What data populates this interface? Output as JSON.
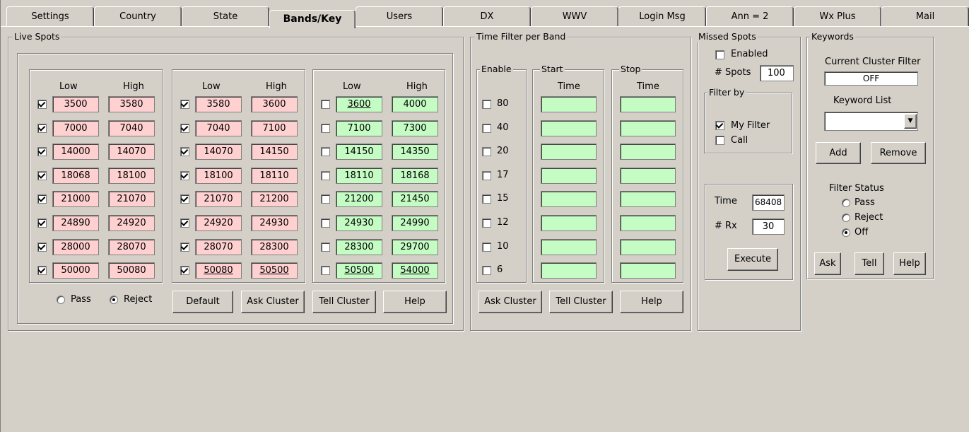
{
  "tabs": [
    "Settings",
    "Country",
    "State",
    "Bands/Key",
    "Users",
    "DX",
    "WWV",
    "Login Msg",
    "Ann = 2",
    "Wx Plus",
    "Mail"
  ],
  "live_spots": {
    "title": "Live Spots",
    "col_low": "Low",
    "col_high": "High",
    "groups": [
      {
        "checked": true,
        "color": "pink",
        "rows": [
          [
            "3500",
            "3580"
          ],
          [
            "7000",
            "7040"
          ],
          [
            "14000",
            "14070"
          ],
          [
            "18068",
            "18100"
          ],
          [
            "21000",
            "21070"
          ],
          [
            "24890",
            "24920"
          ],
          [
            "28000",
            "28070"
          ],
          [
            "50000",
            "50080"
          ]
        ]
      },
      {
        "checked": true,
        "color": "pink",
        "rows": [
          [
            "3580",
            "3600"
          ],
          [
            "7040",
            "7100"
          ],
          [
            "14070",
            "14150"
          ],
          [
            "18100",
            "18110"
          ],
          [
            "21070",
            "21200"
          ],
          [
            "24920",
            "24930"
          ],
          [
            "28070",
            "28300"
          ],
          [
            "50080",
            "50500"
          ]
        ]
      },
      {
        "checked": false,
        "color": "green",
        "rows": [
          [
            "3600",
            "4000"
          ],
          [
            "7100",
            "7300"
          ],
          [
            "14150",
            "14350"
          ],
          [
            "18110",
            "18168"
          ],
          [
            "21200",
            "21450"
          ],
          [
            "24930",
            "24990"
          ],
          [
            "28300",
            "29700"
          ],
          [
            "50500",
            "54000"
          ]
        ]
      }
    ],
    "pass_label": "Pass",
    "reject_label": "Reject",
    "default_btn": "Default",
    "ask_btn": "Ask Cluster",
    "tell_btn": "Tell Cluster",
    "help_btn": "Help"
  },
  "time_filter": {
    "title": "Time Filter per Band",
    "enable_title": "Enable",
    "start_title": "Start",
    "stop_title": "Stop",
    "time_label": "Time",
    "bands": [
      "80",
      "40",
      "20",
      "17",
      "15",
      "12",
      "10",
      "6"
    ],
    "ask_btn": "Ask Cluster",
    "tell_btn": "Tell Cluster",
    "help_btn": "Help"
  },
  "missed": {
    "title": "Missed Spots",
    "enabled_label": "Enabled",
    "spots_label": "# Spots",
    "spots_value": "100",
    "filter_by_title": "Filter by",
    "my_filter_label": "My Filter",
    "call_label": "Call",
    "time_label": "Time",
    "time_value": "68408",
    "rx_label": "# Rx",
    "rx_value": "30",
    "execute_btn": "Execute"
  },
  "keywords": {
    "title": "Keywords",
    "current_filter_label": "Current Cluster Filter",
    "current_filter_value": "OFF",
    "keyword_list_label": "Keyword List",
    "add_btn": "Add",
    "remove_btn": "Remove",
    "filter_status_label": "Filter Status",
    "pass_label": "Pass",
    "reject_label": "Reject",
    "off_label": "Off",
    "ask_btn": "Ask",
    "tell_btn": "Tell",
    "help_btn": "Help"
  }
}
